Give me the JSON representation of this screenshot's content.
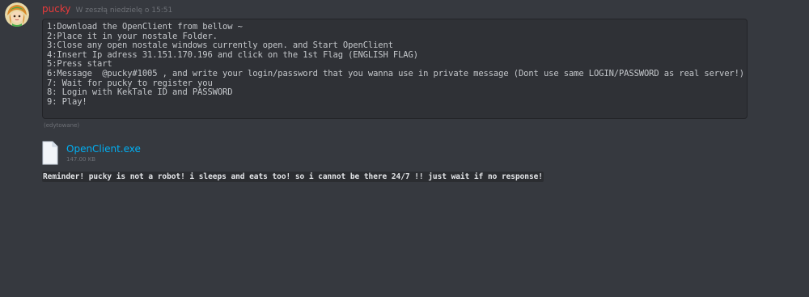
{
  "message": {
    "author": "pucky",
    "author_color": "#ea3b3b",
    "timestamp": "W zeszłą niedzielę o 15:51",
    "code_lines": [
      "1:Download the OpenClient from bellow ~",
      "2:Place it in your nostale Folder.",
      "3:Close any open nostale windows currently open. and Start OpenClient",
      "4:Insert Ip adress 31.151.170.196 and click on the 1st Flag (ENGLISH FLAG)",
      "5:Press start",
      "6:Message  @pucky#1005 , and write your login/password that you wanna use in private message (Dont use same LOGIN/PASSWORD as real server!)",
      "7: Wait for pucky to register you",
      "8: Login with KekTale ID and PASSWORD",
      "9: Play!"
    ],
    "edited_label": "(edytowane)"
  },
  "attachment": {
    "icon": "file-icon",
    "filename": "OpenClient.exe",
    "filename_color": "#00b0f4",
    "size": "147.00 KB"
  },
  "reminder": {
    "text": "Reminder! pucky is not a robot! i sleeps and eats too! so i cannot be there 24/7 !! just wait if no response!"
  },
  "avatar": {
    "icon": "anime-character-avatar"
  }
}
